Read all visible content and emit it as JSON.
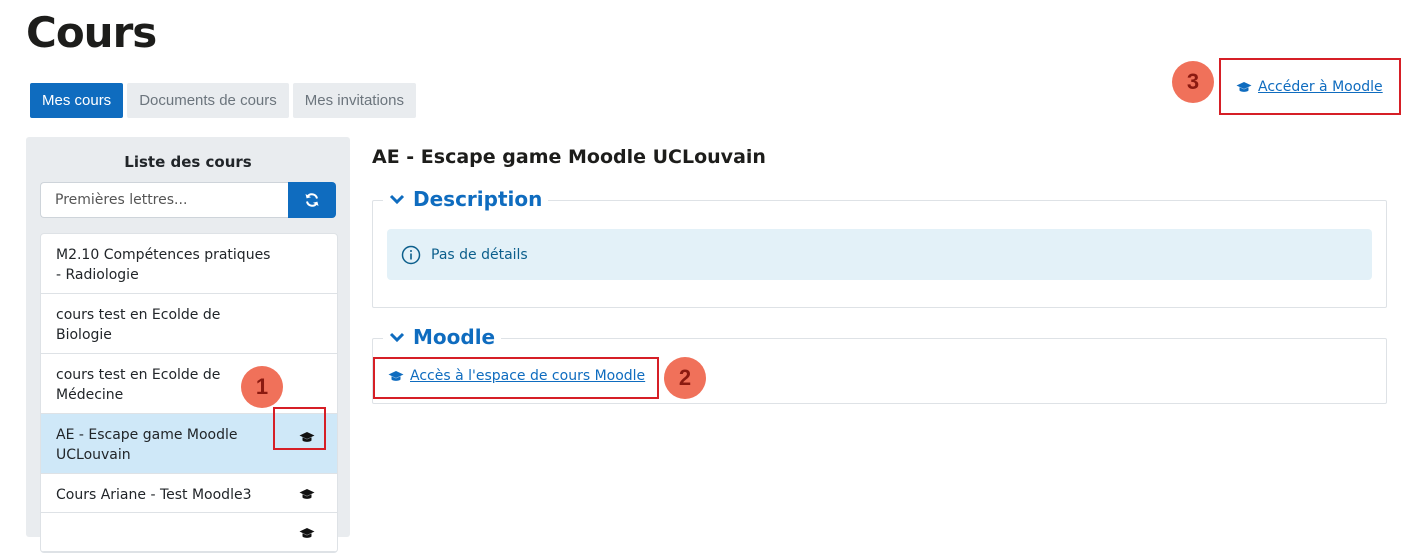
{
  "page": {
    "title": "Cours"
  },
  "tabs": [
    {
      "label": "Mes cours",
      "active": true
    },
    {
      "label": "Documents de cours",
      "active": false
    },
    {
      "label": "Mes invitations",
      "active": false
    }
  ],
  "sidebar": {
    "title": "Liste des cours",
    "search": {
      "placeholder": "Premières lettres...",
      "value": ""
    },
    "refresh_icon": "refresh-icon",
    "courses": [
      {
        "label": "M2.10 Compétences pratiques - Radiologie",
        "moodle": false,
        "active": false
      },
      {
        "label": "cours test en Ecolde de Biologie",
        "moodle": false,
        "active": false
      },
      {
        "label": "cours test en Ecolde de Médecine",
        "moodle": false,
        "active": false
      },
      {
        "label": "AE - Escape game Moodle UCLouvain",
        "moodle": true,
        "active": true
      },
      {
        "label": "Cours Ariane - Test Moodle3",
        "moodle": true,
        "active": false
      }
    ]
  },
  "main": {
    "course_title": "AE - Escape game Moodle UCLouvain",
    "description": {
      "heading": "Description",
      "info": "Pas de détails"
    },
    "moodle": {
      "heading": "Moodle",
      "link_label": "Accès à l'espace de cours Moodle"
    },
    "access_link": "Accéder à Moodle"
  },
  "annotations": [
    "1",
    "2",
    "3"
  ],
  "colors": {
    "primary": "#0f6cbf",
    "highlight": "#d61f26",
    "marker": "#f0715a",
    "active_row": "#cfe8f8"
  }
}
